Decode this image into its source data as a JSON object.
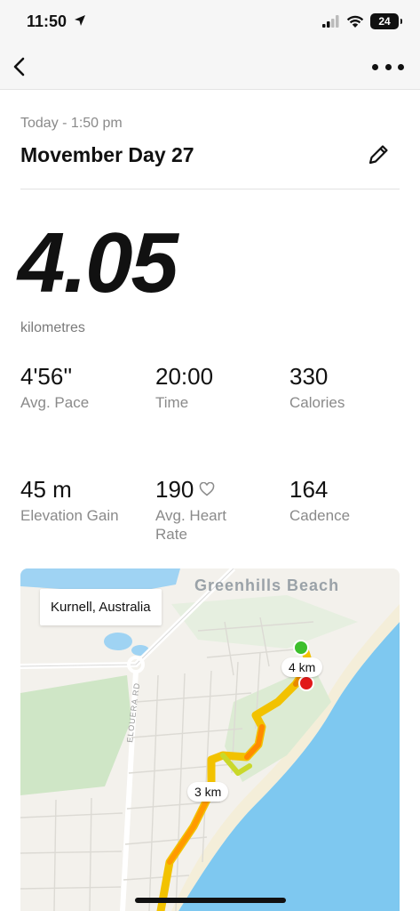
{
  "status_bar": {
    "time": "11:50",
    "battery": "24"
  },
  "header": {
    "back_icon": "chevron-left-icon",
    "more_icon": "more-horizontal-icon"
  },
  "workout": {
    "date": "Today - 1:50 pm",
    "title": "Movember Day 27",
    "distance": "4.05",
    "distance_unit": "kilometres"
  },
  "stats": [
    {
      "value": "4'56''",
      "label": "Avg. Pace"
    },
    {
      "value": "20:00",
      "label": "Time"
    },
    {
      "value": "330",
      "label": "Calories"
    },
    {
      "value": "45 m",
      "label": "Elevation Gain"
    },
    {
      "value": "190",
      "label": "Avg. Heart Rate",
      "icon": "heart-icon"
    },
    {
      "value": "164",
      "label": "Cadence"
    }
  ],
  "map": {
    "location": "Kurnell, Australia",
    "area_label": "Greenhills Beach",
    "road_label": "ELOUERA RD",
    "markers": [
      "4 km",
      "3 km"
    ],
    "colors": {
      "water": "#7ec8f0",
      "route_fast": "#ff9a00",
      "route_slow": "#f2d600",
      "start": "#3dbf2c",
      "end": "#e11919"
    }
  }
}
